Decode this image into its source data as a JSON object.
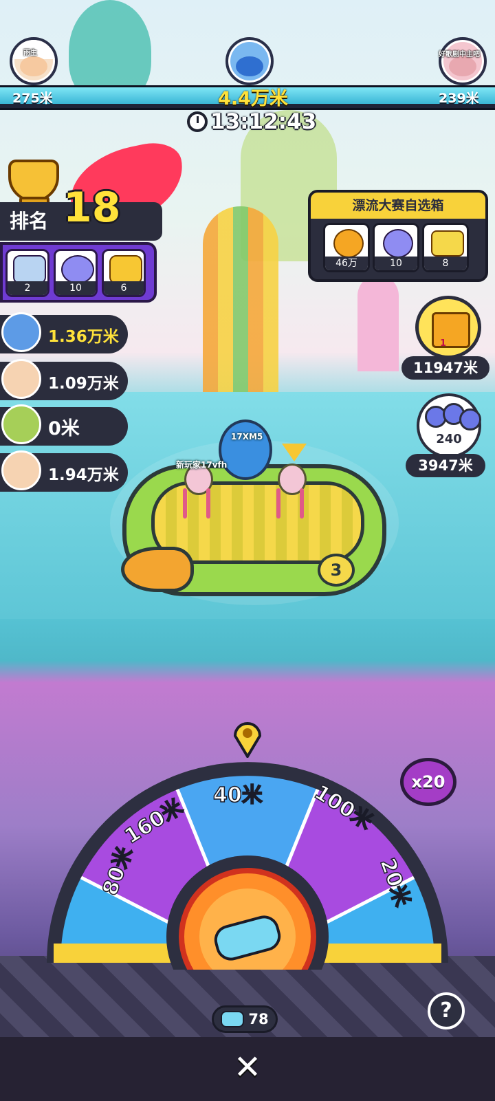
{
  "race": {
    "left_player": {
      "name": "雨生",
      "distance": "275米"
    },
    "right_player": {
      "name": "好歌剧中主吧",
      "distance": "239米"
    },
    "total_distance": "4.4万米",
    "timer": "13:12:43"
  },
  "rank": {
    "label": "排名",
    "value": "18",
    "rewards": [
      {
        "icon": "mystery-box-icon",
        "count": "2"
      },
      {
        "icon": "cat-capsule-icon",
        "count": "10"
      },
      {
        "icon": "gold-ticket-icon",
        "count": "6"
      }
    ]
  },
  "leaderboard": [
    {
      "distance": "1.36万米",
      "color": "#ffe23a"
    },
    {
      "distance": "1.09万米",
      "color": "#ffffff"
    },
    {
      "distance": "0米",
      "color": "#ffffff"
    },
    {
      "distance": "1.94万米",
      "color": "#ffffff"
    }
  ],
  "chest": {
    "title": "漂流大赛自选箱",
    "items": [
      {
        "icon": "gold-coins-icon",
        "count": "46万"
      },
      {
        "icon": "cat-capsule-icon",
        "count": "10"
      },
      {
        "icon": "treasure-chest-icon",
        "count": "8"
      }
    ]
  },
  "gift": {
    "badge": "1",
    "distance": "11947米"
  },
  "bubbles": {
    "count": "240",
    "distance": "3947米"
  },
  "boat": {
    "number": "3",
    "players": [
      {
        "name": "新玩家17vfh"
      },
      {
        "name": "17XM5"
      }
    ]
  },
  "wheel": {
    "segments": [
      "80米",
      "160米",
      "40米",
      "100米",
      "20米"
    ],
    "multiplier": "x20",
    "tickets": "78"
  },
  "colors": {
    "accent": "#ffe23a",
    "panel": "#2b2d3d",
    "purple": "#6f3bd2"
  }
}
